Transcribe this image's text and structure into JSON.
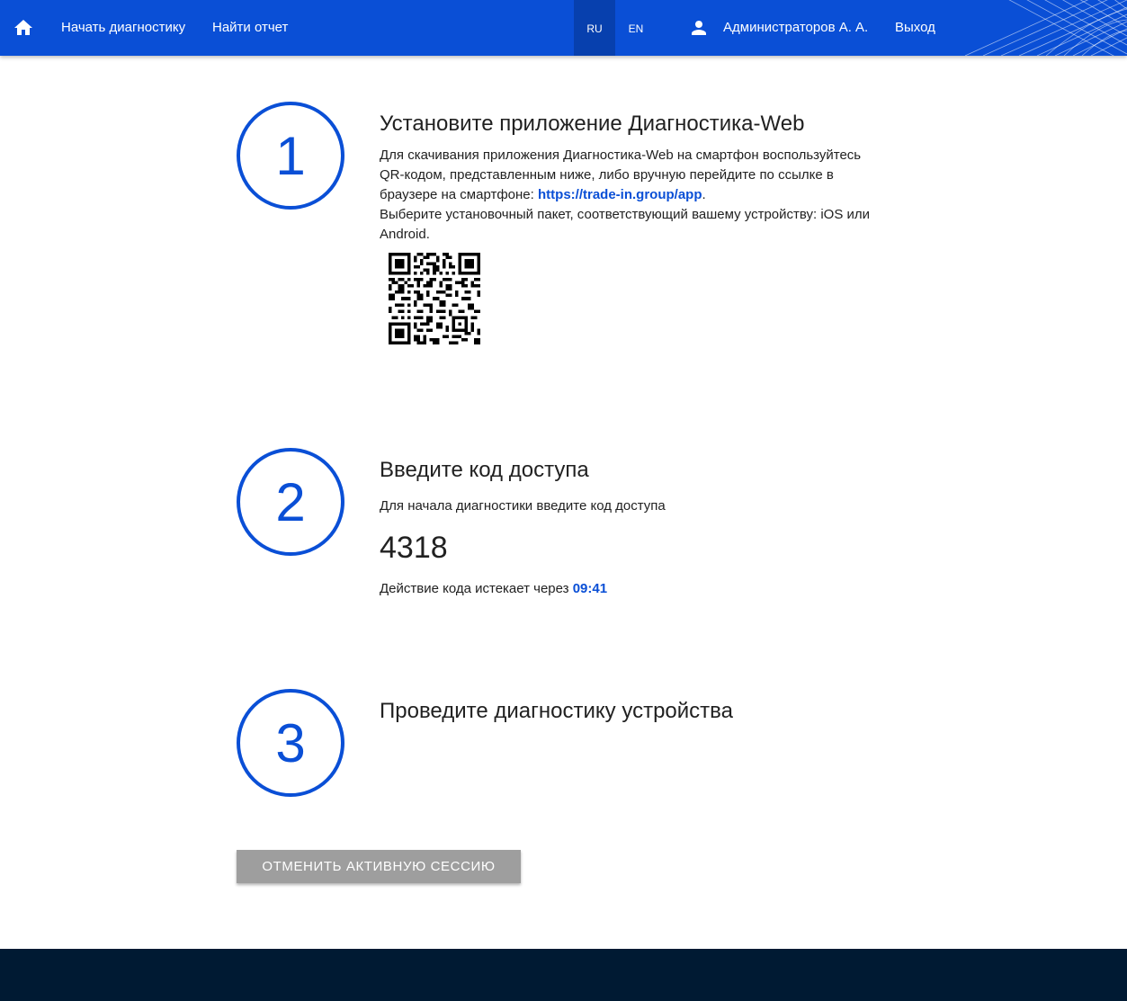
{
  "header": {
    "nav": {
      "start_diagnostics": "Начать диагностику",
      "find_report": "Найти отчет"
    },
    "languages": [
      {
        "label": "RU",
        "active": true
      },
      {
        "label": "EN",
        "active": false
      }
    ],
    "user_name": "Администраторов А. А.",
    "logout": "Выход",
    "icons": {
      "home": "home-icon",
      "user": "account-icon"
    },
    "colors": {
      "primary": "#0a4fd6",
      "active_lang_bg": "#0740ae"
    }
  },
  "steps": [
    {
      "number": "1",
      "title": "Установите приложение Диагностика-Web",
      "text_before_link": "Для скачивания приложения Диагностика-Web на смартфон воспользуйтесь QR-кодом, представленным ниже, либо вручную перейдите по ссылке в браузере на смартфоне: ",
      "link": "https://trade-in.group/app",
      "text_after_link": ".",
      "text_second": "Выберите установочный пакет, соответствующий вашему устройству: iOS или Android."
    },
    {
      "number": "2",
      "title": "Введите код доступа",
      "subtitle": "Для начала диагностики введите код доступа",
      "access_code": "4318",
      "expires_label": "Действие кода истекает через ",
      "expires_time": "09:41"
    },
    {
      "number": "3",
      "title": "Проведите диагностику устройства"
    }
  ],
  "cancel_button": "ОТМЕНИТЬ АКТИВНУЮ СЕССИЮ",
  "colors": {
    "button_bg": "#9e9e9e",
    "footer_bg": "#001a33"
  }
}
